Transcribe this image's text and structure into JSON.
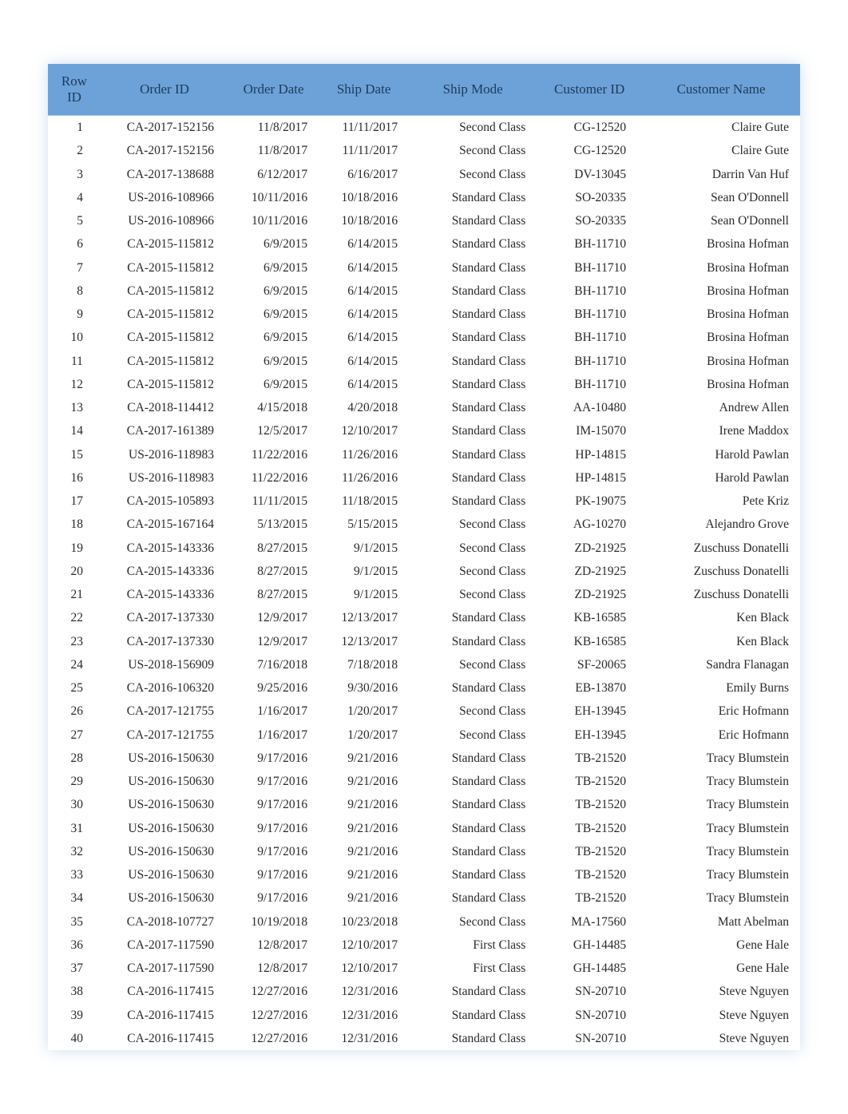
{
  "table": {
    "headers": [
      "Row ID",
      "Order ID",
      "Order Date",
      "Ship Date",
      "Ship Mode",
      "Customer ID",
      "Customer Name"
    ],
    "rows": [
      {
        "row_id": "1",
        "order_id": "CA-2017-152156",
        "order_date": "11/8/2017",
        "ship_date": "11/11/2017",
        "ship_mode": "Second Class",
        "customer_id": "CG-12520",
        "customer_name": "Claire Gute"
      },
      {
        "row_id": "2",
        "order_id": "CA-2017-152156",
        "order_date": "11/8/2017",
        "ship_date": "11/11/2017",
        "ship_mode": "Second Class",
        "customer_id": "CG-12520",
        "customer_name": "Claire Gute"
      },
      {
        "row_id": "3",
        "order_id": "CA-2017-138688",
        "order_date": "6/12/2017",
        "ship_date": "6/16/2017",
        "ship_mode": "Second Class",
        "customer_id": "DV-13045",
        "customer_name": "Darrin Van Huf"
      },
      {
        "row_id": "4",
        "order_id": "US-2016-108966",
        "order_date": "10/11/2016",
        "ship_date": "10/18/2016",
        "ship_mode": "Standard Class",
        "customer_id": "SO-20335",
        "customer_name": "Sean O'Donnell"
      },
      {
        "row_id": "5",
        "order_id": "US-2016-108966",
        "order_date": "10/11/2016",
        "ship_date": "10/18/2016",
        "ship_mode": "Standard Class",
        "customer_id": "SO-20335",
        "customer_name": "Sean O'Donnell"
      },
      {
        "row_id": "6",
        "order_id": "CA-2015-115812",
        "order_date": "6/9/2015",
        "ship_date": "6/14/2015",
        "ship_mode": "Standard Class",
        "customer_id": "BH-11710",
        "customer_name": "Brosina Hofman"
      },
      {
        "row_id": "7",
        "order_id": "CA-2015-115812",
        "order_date": "6/9/2015",
        "ship_date": "6/14/2015",
        "ship_mode": "Standard Class",
        "customer_id": "BH-11710",
        "customer_name": "Brosina Hofman"
      },
      {
        "row_id": "8",
        "order_id": "CA-2015-115812",
        "order_date": "6/9/2015",
        "ship_date": "6/14/2015",
        "ship_mode": "Standard Class",
        "customer_id": "BH-11710",
        "customer_name": "Brosina Hofman"
      },
      {
        "row_id": "9",
        "order_id": "CA-2015-115812",
        "order_date": "6/9/2015",
        "ship_date": "6/14/2015",
        "ship_mode": "Standard Class",
        "customer_id": "BH-11710",
        "customer_name": "Brosina Hofman"
      },
      {
        "row_id": "10",
        "order_id": "CA-2015-115812",
        "order_date": "6/9/2015",
        "ship_date": "6/14/2015",
        "ship_mode": "Standard Class",
        "customer_id": "BH-11710",
        "customer_name": "Brosina Hofman"
      },
      {
        "row_id": "11",
        "order_id": "CA-2015-115812",
        "order_date": "6/9/2015",
        "ship_date": "6/14/2015",
        "ship_mode": "Standard Class",
        "customer_id": "BH-11710",
        "customer_name": "Brosina Hofman"
      },
      {
        "row_id": "12",
        "order_id": "CA-2015-115812",
        "order_date": "6/9/2015",
        "ship_date": "6/14/2015",
        "ship_mode": "Standard Class",
        "customer_id": "BH-11710",
        "customer_name": "Brosina Hofman"
      },
      {
        "row_id": "13",
        "order_id": "CA-2018-114412",
        "order_date": "4/15/2018",
        "ship_date": "4/20/2018",
        "ship_mode": "Standard Class",
        "customer_id": "AA-10480",
        "customer_name": "Andrew Allen"
      },
      {
        "row_id": "14",
        "order_id": "CA-2017-161389",
        "order_date": "12/5/2017",
        "ship_date": "12/10/2017",
        "ship_mode": "Standard Class",
        "customer_id": "IM-15070",
        "customer_name": "Irene Maddox"
      },
      {
        "row_id": "15",
        "order_id": "US-2016-118983",
        "order_date": "11/22/2016",
        "ship_date": "11/26/2016",
        "ship_mode": "Standard Class",
        "customer_id": "HP-14815",
        "customer_name": "Harold Pawlan"
      },
      {
        "row_id": "16",
        "order_id": "US-2016-118983",
        "order_date": "11/22/2016",
        "ship_date": "11/26/2016",
        "ship_mode": "Standard Class",
        "customer_id": "HP-14815",
        "customer_name": "Harold Pawlan"
      },
      {
        "row_id": "17",
        "order_id": "CA-2015-105893",
        "order_date": "11/11/2015",
        "ship_date": "11/18/2015",
        "ship_mode": "Standard Class",
        "customer_id": "PK-19075",
        "customer_name": "Pete Kriz"
      },
      {
        "row_id": "18",
        "order_id": "CA-2015-167164",
        "order_date": "5/13/2015",
        "ship_date": "5/15/2015",
        "ship_mode": "Second Class",
        "customer_id": "AG-10270",
        "customer_name": "Alejandro Grove"
      },
      {
        "row_id": "19",
        "order_id": "CA-2015-143336",
        "order_date": "8/27/2015",
        "ship_date": "9/1/2015",
        "ship_mode": "Second Class",
        "customer_id": "ZD-21925",
        "customer_name": "Zuschuss Donatelli"
      },
      {
        "row_id": "20",
        "order_id": "CA-2015-143336",
        "order_date": "8/27/2015",
        "ship_date": "9/1/2015",
        "ship_mode": "Second Class",
        "customer_id": "ZD-21925",
        "customer_name": "Zuschuss Donatelli"
      },
      {
        "row_id": "21",
        "order_id": "CA-2015-143336",
        "order_date": "8/27/2015",
        "ship_date": "9/1/2015",
        "ship_mode": "Second Class",
        "customer_id": "ZD-21925",
        "customer_name": "Zuschuss Donatelli"
      },
      {
        "row_id": "22",
        "order_id": "CA-2017-137330",
        "order_date": "12/9/2017",
        "ship_date": "12/13/2017",
        "ship_mode": "Standard Class",
        "customer_id": "KB-16585",
        "customer_name": "Ken Black"
      },
      {
        "row_id": "23",
        "order_id": "CA-2017-137330",
        "order_date": "12/9/2017",
        "ship_date": "12/13/2017",
        "ship_mode": "Standard Class",
        "customer_id": "KB-16585",
        "customer_name": "Ken Black"
      },
      {
        "row_id": "24",
        "order_id": "US-2018-156909",
        "order_date": "7/16/2018",
        "ship_date": "7/18/2018",
        "ship_mode": "Second Class",
        "customer_id": "SF-20065",
        "customer_name": "Sandra Flanagan"
      },
      {
        "row_id": "25",
        "order_id": "CA-2016-106320",
        "order_date": "9/25/2016",
        "ship_date": "9/30/2016",
        "ship_mode": "Standard Class",
        "customer_id": "EB-13870",
        "customer_name": "Emily Burns"
      },
      {
        "row_id": "26",
        "order_id": "CA-2017-121755",
        "order_date": "1/16/2017",
        "ship_date": "1/20/2017",
        "ship_mode": "Second Class",
        "customer_id": "EH-13945",
        "customer_name": "Eric Hofmann"
      },
      {
        "row_id": "27",
        "order_id": "CA-2017-121755",
        "order_date": "1/16/2017",
        "ship_date": "1/20/2017",
        "ship_mode": "Second Class",
        "customer_id": "EH-13945",
        "customer_name": "Eric Hofmann"
      },
      {
        "row_id": "28",
        "order_id": "US-2016-150630",
        "order_date": "9/17/2016",
        "ship_date": "9/21/2016",
        "ship_mode": "Standard Class",
        "customer_id": "TB-21520",
        "customer_name": "Tracy Blumstein"
      },
      {
        "row_id": "29",
        "order_id": "US-2016-150630",
        "order_date": "9/17/2016",
        "ship_date": "9/21/2016",
        "ship_mode": "Standard Class",
        "customer_id": "TB-21520",
        "customer_name": "Tracy Blumstein"
      },
      {
        "row_id": "30",
        "order_id": "US-2016-150630",
        "order_date": "9/17/2016",
        "ship_date": "9/21/2016",
        "ship_mode": "Standard Class",
        "customer_id": "TB-21520",
        "customer_name": "Tracy Blumstein"
      },
      {
        "row_id": "31",
        "order_id": "US-2016-150630",
        "order_date": "9/17/2016",
        "ship_date": "9/21/2016",
        "ship_mode": "Standard Class",
        "customer_id": "TB-21520",
        "customer_name": "Tracy Blumstein"
      },
      {
        "row_id": "32",
        "order_id": "US-2016-150630",
        "order_date": "9/17/2016",
        "ship_date": "9/21/2016",
        "ship_mode": "Standard Class",
        "customer_id": "TB-21520",
        "customer_name": "Tracy Blumstein"
      },
      {
        "row_id": "33",
        "order_id": "US-2016-150630",
        "order_date": "9/17/2016",
        "ship_date": "9/21/2016",
        "ship_mode": "Standard Class",
        "customer_id": "TB-21520",
        "customer_name": "Tracy Blumstein"
      },
      {
        "row_id": "34",
        "order_id": "US-2016-150630",
        "order_date": "9/17/2016",
        "ship_date": "9/21/2016",
        "ship_mode": "Standard Class",
        "customer_id": "TB-21520",
        "customer_name": "Tracy Blumstein"
      },
      {
        "row_id": "35",
        "order_id": "CA-2018-107727",
        "order_date": "10/19/2018",
        "ship_date": "10/23/2018",
        "ship_mode": "Second Class",
        "customer_id": "MA-17560",
        "customer_name": "Matt Abelman"
      },
      {
        "row_id": "36",
        "order_id": "CA-2017-117590",
        "order_date": "12/8/2017",
        "ship_date": "12/10/2017",
        "ship_mode": "First Class",
        "customer_id": "GH-14485",
        "customer_name": "Gene Hale"
      },
      {
        "row_id": "37",
        "order_id": "CA-2017-117590",
        "order_date": "12/8/2017",
        "ship_date": "12/10/2017",
        "ship_mode": "First Class",
        "customer_id": "GH-14485",
        "customer_name": "Gene Hale"
      },
      {
        "row_id": "38",
        "order_id": "CA-2016-117415",
        "order_date": "12/27/2016",
        "ship_date": "12/31/2016",
        "ship_mode": "Standard Class",
        "customer_id": "SN-20710",
        "customer_name": "Steve Nguyen"
      },
      {
        "row_id": "39",
        "order_id": "CA-2016-117415",
        "order_date": "12/27/2016",
        "ship_date": "12/31/2016",
        "ship_mode": "Standard Class",
        "customer_id": "SN-20710",
        "customer_name": "Steve Nguyen"
      },
      {
        "row_id": "40",
        "order_id": "CA-2016-117415",
        "order_date": "12/27/2016",
        "ship_date": "12/31/2016",
        "ship_mode": "Standard Class",
        "customer_id": "SN-20710",
        "customer_name": "Steve Nguyen"
      }
    ]
  }
}
